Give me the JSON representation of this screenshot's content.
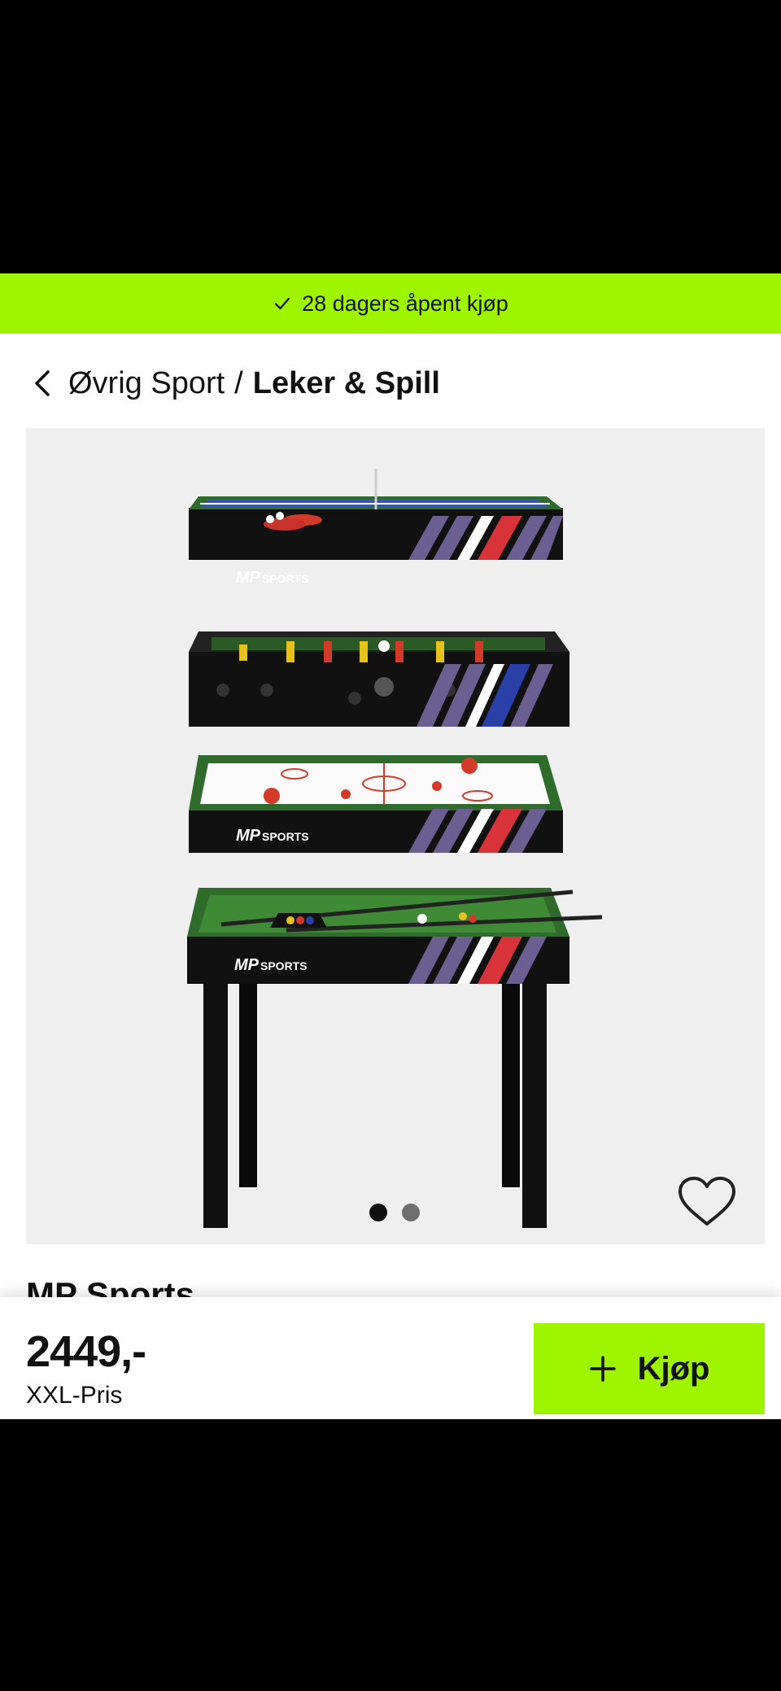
{
  "promo": {
    "text": "28 dagers åpent kjøp",
    "icon": "check-icon"
  },
  "breadcrumb": {
    "parent": "Øvrig Sport",
    "separator": "/",
    "current": "Leker & Spill"
  },
  "gallery": {
    "logo_text": "MP",
    "logo_subtext": "SPORTS",
    "image_count": 2,
    "active_image": 1
  },
  "product": {
    "title": "MP Sports"
  },
  "purchase": {
    "price": "2449,-",
    "price_label": "XXL-Pris",
    "button_label": "Kjøp"
  },
  "colors": {
    "accent": "#9ff500",
    "background": "#efeff0",
    "text": "#111111"
  }
}
